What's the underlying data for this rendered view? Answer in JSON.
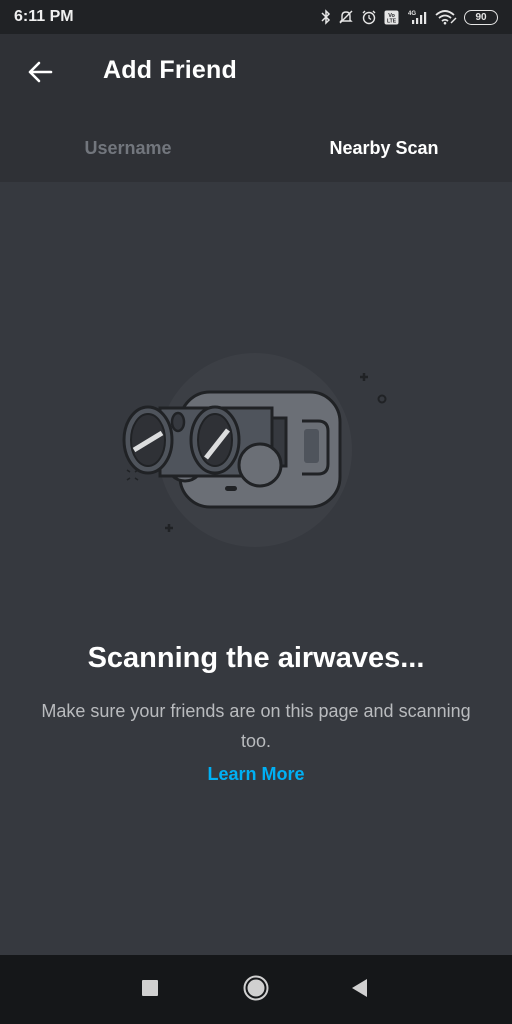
{
  "status_bar": {
    "time": "6:11 PM",
    "icons": [
      "bluetooth-icon",
      "notifications-off-icon",
      "alarm-icon",
      "volte-icon",
      "signal-4g-icon",
      "wifi-icon"
    ],
    "network_label": "4G",
    "volte_label": "Vo LTE",
    "battery": "90"
  },
  "header": {
    "title": "Add Friend",
    "back_icon": "arrow-left-icon"
  },
  "tabs": [
    {
      "label": "Username",
      "active": false
    },
    {
      "label": "Nearby Scan",
      "active": true
    }
  ],
  "main": {
    "illustration": "binoculars-phone-illustration",
    "heading": "Scanning the airwaves...",
    "subtext": "Make sure your friends are on this page and scanning too.",
    "learn_more": "Learn More",
    "link_color": "#00b0f4"
  },
  "nav_bar": {
    "buttons": [
      "recents-square-icon",
      "home-circle-icon",
      "back-triangle-icon"
    ]
  }
}
